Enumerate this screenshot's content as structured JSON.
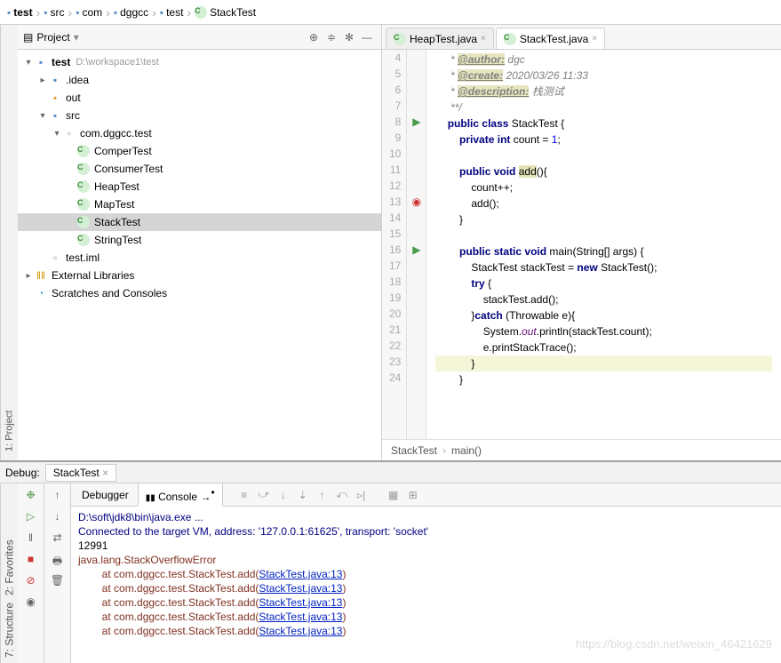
{
  "breadcrumb": [
    "test",
    "src",
    "com",
    "dggcc",
    "test",
    "StackTest"
  ],
  "project": {
    "title": "Project",
    "root": {
      "name": "test",
      "path": "D:\\workspace1\\test"
    },
    "idea": ".idea",
    "out": "out",
    "src": "src",
    "pkg": "com.dggcc.test",
    "classes": [
      "ComperTest",
      "ConsumerTest",
      "HeapTest",
      "MapTest",
      "StackTest",
      "StringTest"
    ],
    "iml": "test.iml",
    "ext": "External Libraries",
    "scratch": "Scratches and Consoles"
  },
  "tabs": [
    {
      "name": "HeapTest.java",
      "active": false
    },
    {
      "name": "StackTest.java",
      "active": true
    }
  ],
  "code": {
    "start": 4,
    "lines": [
      {
        "n": 4,
        "t": "doc",
        "pre": "     * ",
        "tag": "@author:",
        "rest": " dgc"
      },
      {
        "n": 5,
        "t": "doc",
        "pre": "     * ",
        "tag": "@create:",
        "rest": " 2020/03/26 11:33"
      },
      {
        "n": 6,
        "t": "doc",
        "pre": "     * ",
        "tag": "@description:",
        "rest": " 栈测试"
      },
      {
        "n": 7,
        "t": "docend",
        "txt": "     **/"
      },
      {
        "n": 8,
        "t": "c",
        "icon": "play",
        "txt": "    public class StackTest {"
      },
      {
        "n": 9,
        "t": "c",
        "txt": "        private int count = 1;"
      },
      {
        "n": 10,
        "t": "b",
        "txt": ""
      },
      {
        "n": 11,
        "t": "c",
        "txt": "        public void add(){",
        "hl": "add"
      },
      {
        "n": 12,
        "t": "c",
        "txt": "            count++;"
      },
      {
        "n": 13,
        "t": "c",
        "icon": "bp",
        "txt": "            add();"
      },
      {
        "n": 14,
        "t": "c",
        "txt": "        }"
      },
      {
        "n": 15,
        "t": "b",
        "txt": ""
      },
      {
        "n": 16,
        "t": "c",
        "icon": "play",
        "txt": "        public static void main(String[] args) {"
      },
      {
        "n": 17,
        "t": "c",
        "txt": "            StackTest stackTest = new StackTest();"
      },
      {
        "n": 18,
        "t": "c",
        "txt": "            try {"
      },
      {
        "n": 19,
        "t": "c",
        "txt": "                stackTest.add();"
      },
      {
        "n": 20,
        "t": "c",
        "txt": "            }catch (Throwable e){"
      },
      {
        "n": 21,
        "t": "c",
        "txt": "                System.out.println(stackTest.count);"
      },
      {
        "n": 22,
        "t": "c",
        "txt": "                e.printStackTrace();"
      },
      {
        "n": 23,
        "t": "c",
        "txt": "            }",
        "hlrow": true
      },
      {
        "n": 24,
        "t": "c",
        "txt": "        }"
      }
    ]
  },
  "crumbs": [
    "StackTest",
    "main()"
  ],
  "debug": {
    "header": "Debug:",
    "run": "StackTest",
    "tabs": {
      "debugger": "Debugger",
      "console": "Console"
    },
    "console": {
      "cmd": "D:\\soft\\jdk8\\bin\\java.exe ...",
      "conn": "Connected to the target VM, address: '127.0.0.1:61625', transport: 'socket'",
      "out": "12991",
      "err": "java.lang.StackOverflowError",
      "trace_pre": "\tat com.dggcc.test.StackTest.add(",
      "trace_link": "StackTest.java:13",
      "trace_post": ")",
      "trace_count": 5
    }
  },
  "left_tabs": [
    "1: Project"
  ],
  "bottom_left_tabs": [
    "7: Structure",
    "2: Favorites"
  ],
  "watermark": "https://blog.csdn.net/weixin_46421629"
}
